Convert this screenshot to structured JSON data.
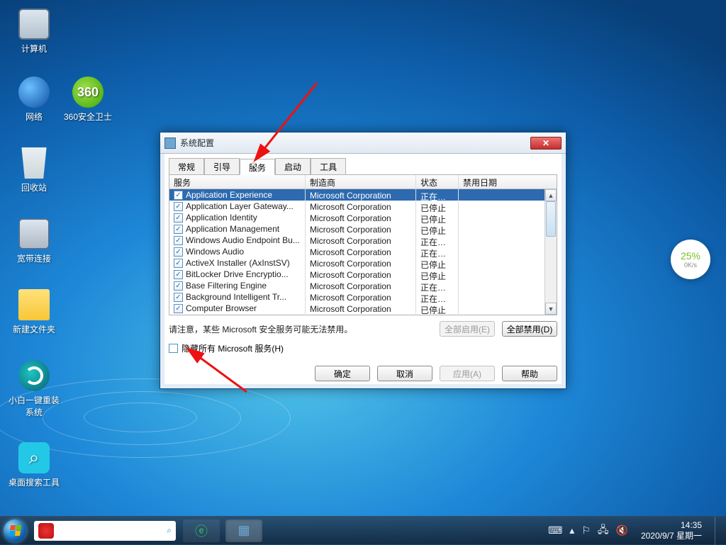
{
  "desktop_icons": {
    "computer": "计算机",
    "network": "网络",
    "recycle": "回收站",
    "broadband": "宽带连接",
    "folder": "新建文件夹",
    "reinstall": "小白一键重装\n系统",
    "search_tool": "桌面搜索工具",
    "safe360": "360安全卫士"
  },
  "float_meter": {
    "percent": "25%",
    "speed": "0K/s"
  },
  "dialog": {
    "title": "系统配置",
    "tabs": [
      "常规",
      "引导",
      "服务",
      "启动",
      "工具"
    ],
    "active_tab_index": 2,
    "columns": {
      "service": "服务",
      "manufacturer": "制造商",
      "status": "状态",
      "disabled_date": "禁用日期"
    },
    "rows": [
      {
        "checked": true,
        "svc": "Application Experience",
        "mfr": "Microsoft Corporation",
        "st": "正在运行",
        "selected": true
      },
      {
        "checked": true,
        "svc": "Application Layer Gateway...",
        "mfr": "Microsoft Corporation",
        "st": "已停止"
      },
      {
        "checked": true,
        "svc": "Application Identity",
        "mfr": "Microsoft Corporation",
        "st": "已停止"
      },
      {
        "checked": true,
        "svc": "Application Management",
        "mfr": "Microsoft Corporation",
        "st": "已停止"
      },
      {
        "checked": true,
        "svc": "Windows Audio Endpoint Bu...",
        "mfr": "Microsoft Corporation",
        "st": "正在运行"
      },
      {
        "checked": true,
        "svc": "Windows Audio",
        "mfr": "Microsoft Corporation",
        "st": "正在运行"
      },
      {
        "checked": true,
        "svc": "ActiveX Installer (AxInstSV)",
        "mfr": "Microsoft Corporation",
        "st": "已停止"
      },
      {
        "checked": true,
        "svc": "BitLocker Drive Encryptio...",
        "mfr": "Microsoft Corporation",
        "st": "已停止"
      },
      {
        "checked": true,
        "svc": "Base Filtering Engine",
        "mfr": "Microsoft Corporation",
        "st": "正在运行"
      },
      {
        "checked": true,
        "svc": "Background Intelligent Tr...",
        "mfr": "Microsoft Corporation",
        "st": "正在运行"
      },
      {
        "checked": true,
        "svc": "Computer Browser",
        "mfr": "Microsoft Corporation",
        "st": "已停止"
      }
    ],
    "note": "请注意，某些 Microsoft 安全服务可能无法禁用。",
    "enable_all": "全部启用(E)",
    "disable_all": "全部禁用(D)",
    "hide_ms": "隐藏所有 Microsoft 服务(H)",
    "ok": "确定",
    "cancel": "取消",
    "apply": "应用(A)",
    "help": "帮助"
  },
  "taskbar": {
    "time": "14:35",
    "date": "2020/9/7 星期一"
  }
}
